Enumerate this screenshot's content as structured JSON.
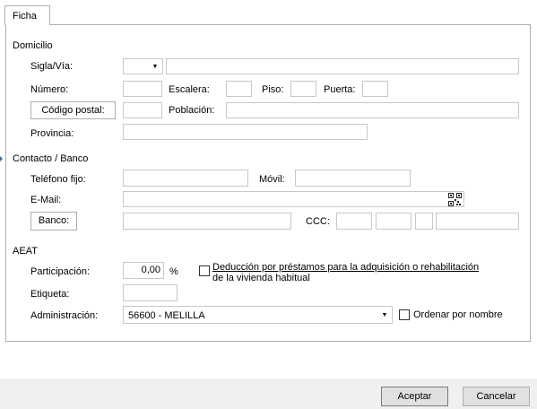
{
  "tab": {
    "label": "Ficha"
  },
  "domicilio": {
    "section_label": "Domicilio",
    "sigla_label": "Sigla/Vía:",
    "sigla_value": "",
    "via_value": "",
    "numero_label": "Número:",
    "numero_value": "",
    "escalera_label": "Escalera:",
    "escalera_value": "",
    "piso_label": "Piso:",
    "piso_value": "",
    "puerta_label": "Puerta:",
    "puerta_value": "",
    "codigo_postal_button": "Código postal:",
    "codigo_postal_value": "",
    "poblacion_label": "Población:",
    "poblacion_value": "",
    "provincia_label": "Provincia:",
    "provincia_value": ""
  },
  "contacto": {
    "section_label": "Contacto / Banco",
    "telefono_label": "Teléfono fijo:",
    "telefono_value": "",
    "movil_label": "Móvil:",
    "movil_value": "",
    "email_label": "E-Mail:",
    "email_value": "",
    "qr_icon": "qr-code-icon",
    "banco_button": "Banco:",
    "banco_value": "",
    "ccc_label": "CCC:",
    "ccc_values": [
      "",
      "",
      "",
      ""
    ]
  },
  "aeat": {
    "section_label": "AEAT",
    "participacion_label": "Participación:",
    "participacion_value": "0,00",
    "participacion_unit": "%",
    "deduccion_label_line1": "Deducción por préstamos para la adquisición o rehabilitación",
    "deduccion_label_line2": "de la vivienda habitual",
    "deduccion_checked": false,
    "etiqueta_label": "Etiqueta:",
    "etiqueta_value": "",
    "administracion_label": "Administración:",
    "administracion_value": "56600 - MELILLA",
    "ordenar_label": "Ordenar por nombre",
    "ordenar_checked": false
  },
  "footer": {
    "aceptar": "Aceptar",
    "cancelar": "Cancelar"
  },
  "colors": {
    "border": "#adadad",
    "field_border": "#c8c8c8",
    "footer_bg": "#f0f0f0",
    "marker": "#2a6fb0"
  }
}
